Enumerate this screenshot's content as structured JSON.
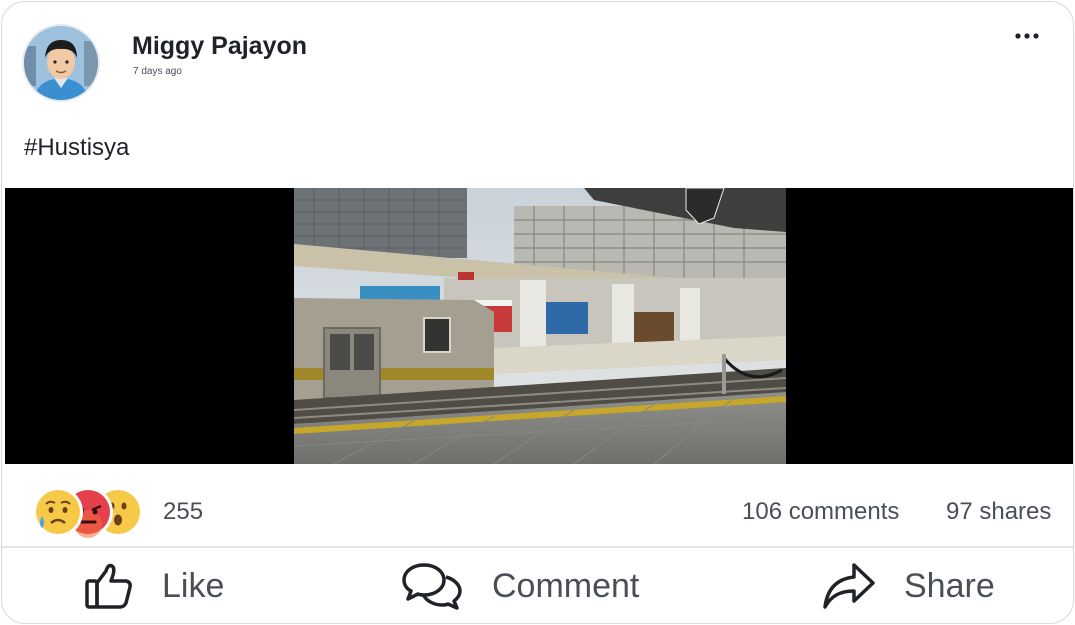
{
  "post": {
    "author": "Miggy Pajayon",
    "timestamp": "7 days ago",
    "text": "#Hustisya",
    "more_icon": "more-horizontal-icon"
  },
  "stats": {
    "reactions": [
      "sad-emoji",
      "angry-emoji",
      "wow-emoji"
    ],
    "reaction_count": "255",
    "comments": "106 comments",
    "shares": "97 shares"
  },
  "actions": {
    "like": "Like",
    "comment": "Comment",
    "share": "Share"
  },
  "colors": {
    "text": "#1f2329",
    "muted": "#4a4f57",
    "border": "#d6d9de"
  }
}
